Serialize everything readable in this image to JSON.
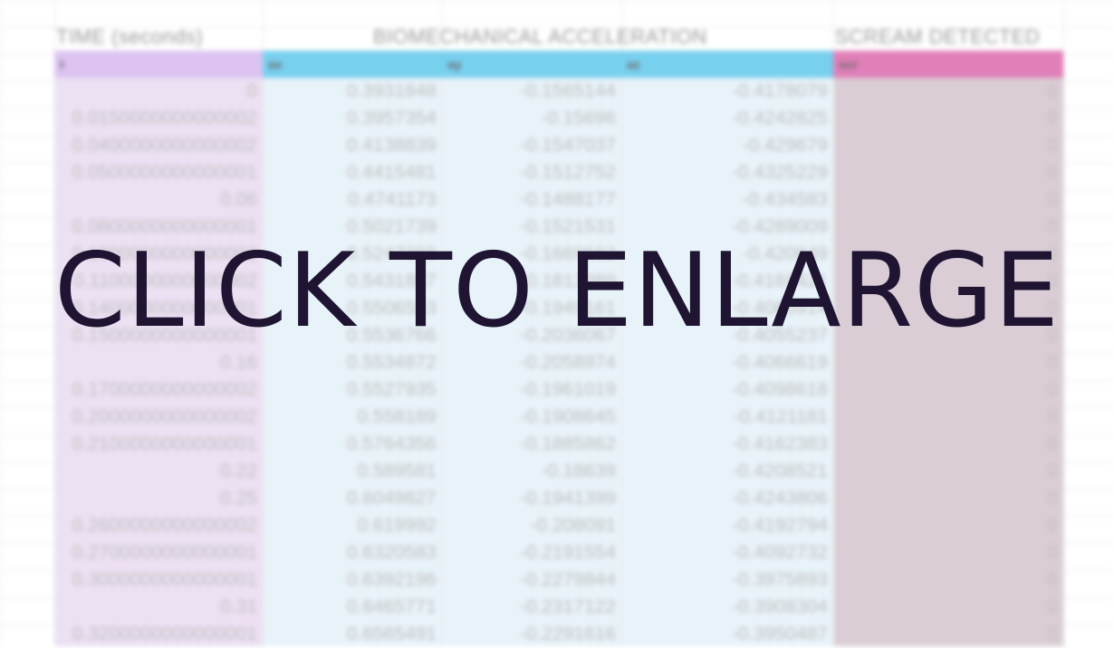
{
  "overlay": {
    "label": "CLICK TO ENLARGE"
  },
  "colors": {
    "time_column": "#ece0f3",
    "time_header": "#dcc3f1",
    "accel_column": "#e8f3f9",
    "accel_header": "#78d0ef",
    "scream_column": "#dacdd5",
    "scream_header": "#e07fb8",
    "overlay_text": "#1f1533"
  },
  "sheet": {
    "group_headers": {
      "time": "TIME (seconds)",
      "acceleration": "BIOMECHANICAL ACCELERATION",
      "scream": "SCREAM DETECTED"
    },
    "column_headers": [
      "t",
      "ax",
      "ay",
      "az",
      "scr"
    ],
    "rows": [
      [
        "0",
        "0.3931848",
        "-0.1565144",
        "-0.4178079",
        "0"
      ],
      [
        "0.0150000000000002",
        "0.3957354",
        "-0.15696",
        "-0.4242825",
        "0"
      ],
      [
        "0.0400000000000002",
        "0.4138839",
        "-0.1547037",
        "-0.429679",
        "0"
      ],
      [
        "0.0500000000000001",
        "0.4415481",
        "-0.1512752",
        "-0.4325229",
        "0"
      ],
      [
        "0.06",
        "0.4741173",
        "-0.1488177",
        "-0.434583",
        "0"
      ],
      [
        "0.0800000000000001",
        "0.5021739",
        "-0.1521531",
        "-0.4289009",
        "0"
      ],
      [
        "0.1000000000000002",
        "0.5247369",
        "-0.1669662",
        "-0.420849",
        "0"
      ],
      [
        "0.1100000000000002",
        "0.5431887",
        "-0.1813989",
        "-0.4169421",
        "0"
      ],
      [
        "0.1400000000000001",
        "0.5506553",
        "-0.1949161",
        "-0.4085914",
        "0"
      ],
      [
        "0.1500000000000001",
        "0.5536766",
        "-0.2036067",
        "-0.4055237",
        "0"
      ],
      [
        "0.16",
        "0.5534872",
        "-0.2058974",
        "-0.4066619",
        "0"
      ],
      [
        "0.1700000000000002",
        "0.5527935",
        "-0.1961019",
        "-0.4098618",
        "0"
      ],
      [
        "0.2000000000000002",
        "0.558189",
        "-0.1908645",
        "-0.4121181",
        "0"
      ],
      [
        "0.2100000000000001",
        "0.5764356",
        "-0.1885862",
        "-0.4162383",
        "0"
      ],
      [
        "0.22",
        "0.589581",
        "-0.18639",
        "-0.4208521",
        "0"
      ],
      [
        "0.25",
        "0.6049827",
        "-0.1941399",
        "-0.4243806",
        "0"
      ],
      [
        "0.2600000000000002",
        "0.619992",
        "-0.208091",
        "-0.4192794",
        "0"
      ],
      [
        "0.2700000000000001",
        "0.6320583",
        "-0.2191554",
        "-0.4092732",
        "0"
      ],
      [
        "0.3000000000000001",
        "0.6392196",
        "-0.2279844",
        "-0.3975893",
        "0"
      ],
      [
        "0.31",
        "0.6465771",
        "-0.2317122",
        "-0.3908304",
        "0"
      ],
      [
        "0.3200000000000001",
        "0.6565491",
        "-0.2291616",
        "-0.3950487",
        "0"
      ]
    ]
  }
}
